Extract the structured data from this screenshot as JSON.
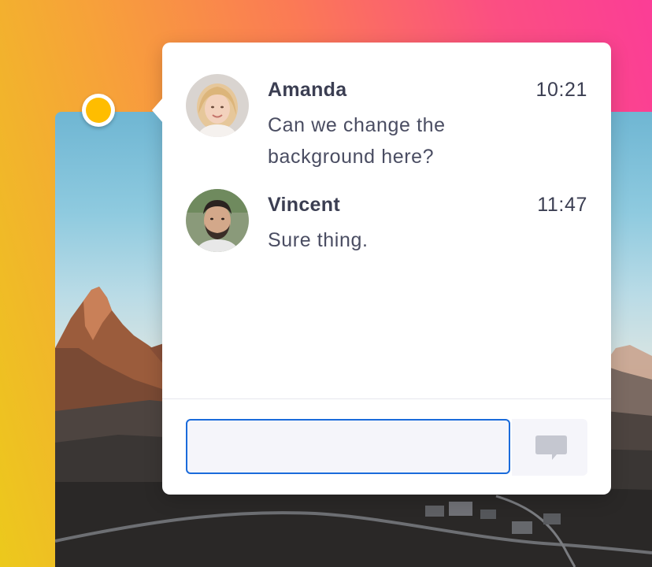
{
  "thread": {
    "messages": [
      {
        "author": "Amanda",
        "time": "10:21",
        "text": "Can we change the background here?",
        "avatar": "woman-portrait"
      },
      {
        "author": "Vincent",
        "time": "11:47",
        "text": "Sure thing.",
        "avatar": "man-portrait"
      }
    ]
  },
  "reply": {
    "value": "",
    "placeholder": "",
    "send_icon": "speech-bubble-icon"
  },
  "colors": {
    "marker": "#ffbd00",
    "input_border": "#1a6bdb",
    "text": "#3b3e52",
    "input_bg": "#f5f5fa"
  }
}
